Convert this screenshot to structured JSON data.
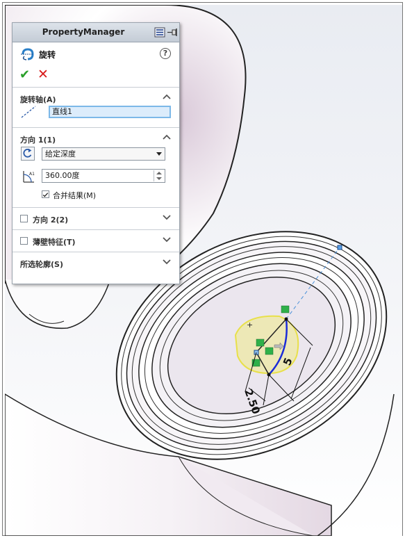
{
  "panel": {
    "title": "PropertyManager",
    "feature_name": "旋转",
    "help_glyph": "?",
    "ok_glyph": "✔",
    "cancel_glyph": "✕"
  },
  "axis_group": {
    "title": "旋转轴(A)",
    "field_value": "直线1"
  },
  "direction1_group": {
    "title": "方向 1(1)",
    "type_value": "给定深度",
    "angle_value": "360.00度",
    "merge_label": "合并结果(M)",
    "merge_checked": true
  },
  "direction2_group": {
    "title": "方向 2(2)",
    "checked": false
  },
  "thin_group": {
    "title": "薄壁特征(T)",
    "checked": false
  },
  "contours_group": {
    "title": "所选轮廓(S)"
  },
  "dimensions": {
    "d1": "2.50",
    "d2": "5"
  },
  "icons": {
    "pin": "pin-icon",
    "display": "display-icon",
    "feature": "revolve-icon",
    "axis": "axis-line-icon",
    "reverse": "reverse-direction-icon",
    "angle": "angle-icon"
  },
  "colors": {
    "accent_field": "#7cb8e8",
    "ok": "#2aa02a",
    "cancel": "#d81b1b",
    "sketch": "#1a2bd8",
    "preview": "#f0ec70",
    "relation": "#2fb04a"
  }
}
